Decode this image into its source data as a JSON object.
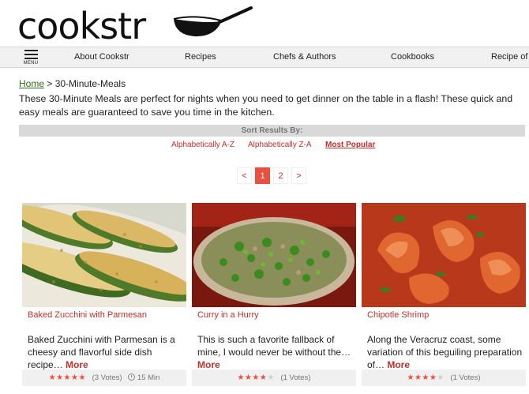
{
  "brand": {
    "name": "cookstr",
    "logo_icon": "frying-pan-icon"
  },
  "nav": {
    "menu_label": "MENU",
    "items": [
      {
        "label": "About Cookstr"
      },
      {
        "label": "Recipes"
      },
      {
        "label": "Chefs & Authors"
      },
      {
        "label": "Cookbooks"
      },
      {
        "label": "Recipe of t"
      }
    ]
  },
  "breadcrumb": {
    "home": "Home",
    "separator": " > ",
    "current": "30-Minute-Meals"
  },
  "intro": "These 30-Minute Meals are perfect for nights when you need to get dinner on the table in a flash! These quick and easy meals are guaranteed to save you time in the kitchen.",
  "sort": {
    "heading": "Sort Results By:",
    "options": [
      {
        "label": "Alphabetically A-Z",
        "active": false
      },
      {
        "label": "Alphabetically Z-A",
        "active": false
      },
      {
        "label": "Most Popular",
        "active": true
      }
    ]
  },
  "pagination": {
    "prev": "<",
    "pages": [
      "1",
      "2"
    ],
    "current": "1",
    "next": ">"
  },
  "cards": [
    {
      "title": "Baked Zucchini with Parmesan",
      "description": "Baked Zucchini with Parmesan is a cheesy and flavorful side dish recipe…",
      "more": "More",
      "rating": 5,
      "votes": "(3 Votes)",
      "time": "15 Min"
    },
    {
      "title": "Curry in a Hurry",
      "description": "This is such a favorite fallback of mine, I would never be without the…",
      "more": "More",
      "rating": 4,
      "votes": "(1 Votes)",
      "time": ""
    },
    {
      "title": "Chipotle Shrimp",
      "description": "Along the Veracruz coast, some variation of this beguiling preparation of…",
      "more": "More",
      "rating": 4,
      "votes": "(1 Votes)",
      "time": ""
    }
  ],
  "colors": {
    "accent": "#c0302c",
    "page_active": "#e8503f",
    "home_link": "#2d6a1a"
  }
}
